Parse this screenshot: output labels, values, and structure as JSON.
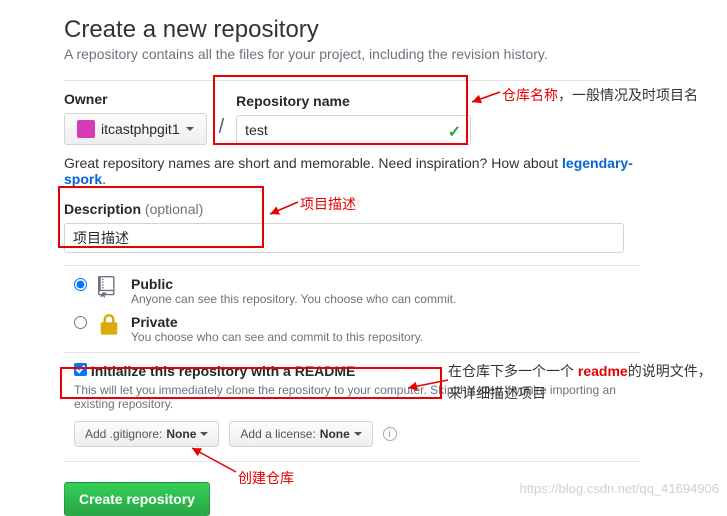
{
  "heading": "Create a new repository",
  "subtitle": "A repository contains all the files for your project, including the revision history.",
  "owner": {
    "label": "Owner",
    "value": "itcastphpgit1"
  },
  "repo_name": {
    "label": "Repository name",
    "value": "test"
  },
  "slash": "/",
  "hint_prefix": "Great repository names are short and memorable. Need inspiration? How about ",
  "hint_suggestion": "legendary-spork",
  "hint_suffix": ".",
  "description": {
    "label": "Description",
    "optional": "(optional)",
    "value": "项目描述"
  },
  "public": {
    "label": "Public",
    "desc": "Anyone can see this repository. You choose who can commit."
  },
  "private": {
    "label": "Private",
    "desc": "You choose who can see and commit to this repository."
  },
  "readme": {
    "label": "Initialize this repository with a README",
    "desc": "This will let you immediately clone the repository to your computer. Skip this step if you're importing an existing repository."
  },
  "gitignore": {
    "prefix": "Add .gitignore: ",
    "value": "None"
  },
  "license": {
    "prefix": "Add a license: ",
    "value": "None"
  },
  "submit": "Create repository",
  "anno": {
    "repo_name_1": "仓库名称",
    "repo_name_2": "，一般情况及时项目名",
    "desc": "项目描述",
    "readme_1": "在仓库下多一个一个 ",
    "readme_kw": "readme",
    "readme_2": "的说明文件，来详细描述项目",
    "create": "创建仓库"
  },
  "watermark": "https://blog.csdn.net/qq_41694906"
}
